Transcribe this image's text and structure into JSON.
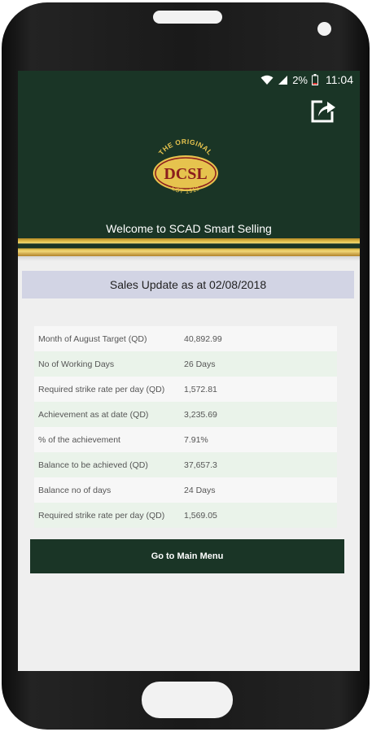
{
  "status_bar": {
    "battery_pct": "2%",
    "time": "11:04"
  },
  "header": {
    "logo_text": {
      "top": "THE ORIGINAL",
      "center": "DCSL",
      "bottom": "EST 1913"
    },
    "welcome": "Welcome to SCAD Smart Selling"
  },
  "update_title": "Sales Update as at 02/08/2018",
  "rows": [
    {
      "label": "Month of August Target (QD)",
      "value": "40,892.99"
    },
    {
      "label": "No of Working Days",
      "value": "26 Days"
    },
    {
      "label": "Required strike rate per day (QD)",
      "value": "1,572.81"
    },
    {
      "label": "Achievement as at date (QD)",
      "value": "3,235.69"
    },
    {
      "label": "% of the achievement",
      "value": "7.91%"
    },
    {
      "label": "Balance to be achieved (QD)",
      "value": "37,657.3"
    },
    {
      "label": "Balance no of days",
      "value": "24 Days"
    },
    {
      "label": "Required strike rate per day (QD)",
      "value": "1,569.05"
    }
  ],
  "main_menu_button": "Go to Main Menu",
  "colors": {
    "brand_green": "#1a3526",
    "gold": "#e6c34e",
    "banner": "#d2d4e4"
  },
  "icons": {
    "share": "share-icon",
    "wifi": "wifi-icon",
    "signal": "signal-icon",
    "battery": "battery-icon"
  }
}
